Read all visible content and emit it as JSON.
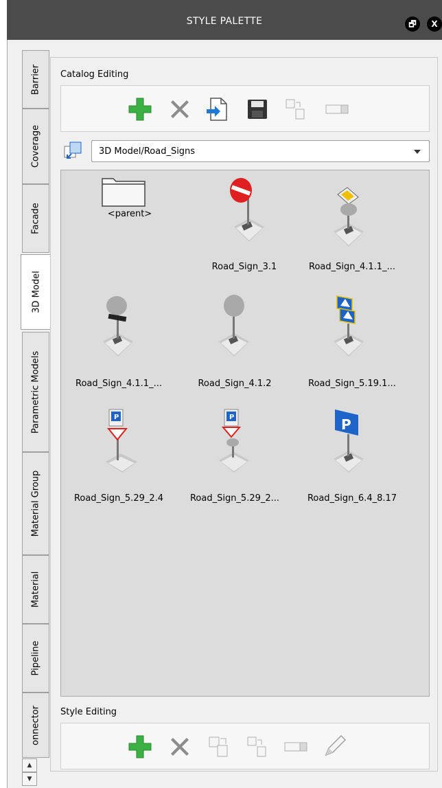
{
  "window": {
    "title": "STYLE PALETTE",
    "restore_label": "🗗",
    "close_label": "X"
  },
  "tabs": [
    {
      "label": "Barrier"
    },
    {
      "label": "Coverage"
    },
    {
      "label": "Facade"
    },
    {
      "label": "3D Model",
      "active": true
    },
    {
      "label": "Parametric Models"
    },
    {
      "label": "Material Group"
    },
    {
      "label": "Material"
    },
    {
      "label": "Pipeline"
    },
    {
      "label": "onnector"
    }
  ],
  "catalog_editing": {
    "label": "Catalog Editing",
    "tools": [
      "add-icon",
      "delete-icon",
      "import-icon",
      "save-icon",
      "copy-icon",
      "rename-icon"
    ]
  },
  "path": {
    "value": "3D Model/Road_Signs"
  },
  "items": [
    {
      "caption": "<parent>",
      "icon": "folder-icon"
    },
    {
      "caption": "Road_Sign_3.1",
      "icon": "no-entry-sign-icon"
    },
    {
      "caption": "Road_Sign_4.1.1_...",
      "icon": "yellow-diamond-sign-icon"
    },
    {
      "caption": "Road_Sign_4.1.1_...",
      "icon": "black-plate-sign-icon"
    },
    {
      "caption": "Road_Sign_4.1.2",
      "icon": "blank-round-sign-icon"
    },
    {
      "caption": "Road_Sign_5.19.1...",
      "icon": "crosswalk-sign-icon"
    },
    {
      "caption": "Road_Sign_5.29_2.4",
      "icon": "parking-yield-sign-icon"
    },
    {
      "caption": "Road_Sign_5.29_2...",
      "icon": "parking-yield-sign-icon"
    },
    {
      "caption": "Road_Sign_6.4_8.17",
      "icon": "parking-sign-icon"
    }
  ],
  "style_editing": {
    "label": "Style Editing",
    "tools": [
      "add-icon",
      "delete-icon",
      "duplicate-icon",
      "copy-icon",
      "rename-icon",
      "edit-icon"
    ]
  },
  "colors": {
    "titlebar": "#4b4b4b",
    "add_green": "#3cb043",
    "parking_blue": "#1e64c8",
    "no_entry_red": "#e02020"
  }
}
